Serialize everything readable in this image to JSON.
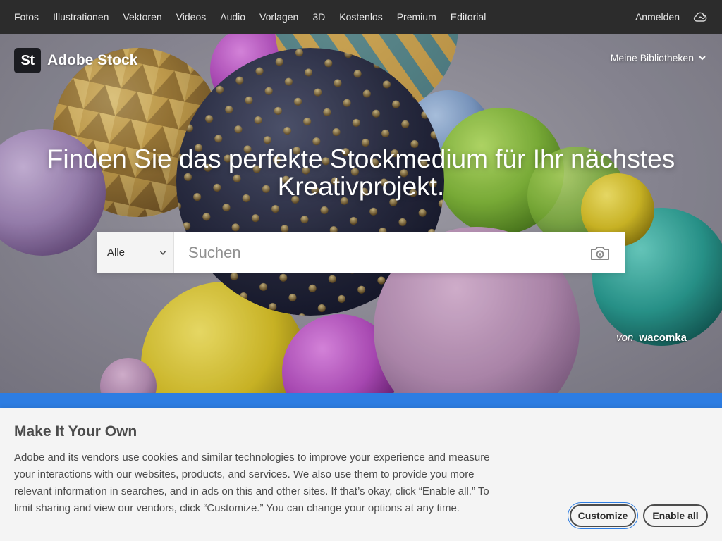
{
  "topnav": {
    "links": [
      "Fotos",
      "Illustrationen",
      "Vektoren",
      "Videos",
      "Audio",
      "Vorlagen",
      "3D",
      "Kostenlos",
      "Premium",
      "Editorial"
    ],
    "signin": "Anmelden",
    "icon": "creative-cloud-icon"
  },
  "brand": {
    "logo_text": "St",
    "name": "Adobe Stock"
  },
  "libraries": {
    "label": "Meine Bibliotheken",
    "icon": "chevron-down-icon"
  },
  "hero": {
    "headline": "Finden Sie das perfekte Stockmedium für Ihr nächstes Kreativprojekt.",
    "credit_by": "von",
    "credit_author": "wacomka"
  },
  "search": {
    "category": "Alle",
    "placeholder": "Suchen",
    "value": "",
    "camera_icon": "camera-icon"
  },
  "cookie": {
    "title": "Make It Your Own",
    "text": "Adobe and its vendors use cookies and similar technologies to improve your experience and measure your interactions with our websites, products, and services. We also use them to provide you more relevant information in searches, and in ads on this and other sites. If that’s okay, click “Enable all.” To limit sharing and view our vendors, click “Customize.” You can change your options at any time.",
    "customize_label": "Customize",
    "enable_label": "Enable all"
  },
  "colors": {
    "nav_bg": "#2c2c2c",
    "accent_blue": "#2d7de2",
    "banner_bg": "#f4f4f4"
  }
}
